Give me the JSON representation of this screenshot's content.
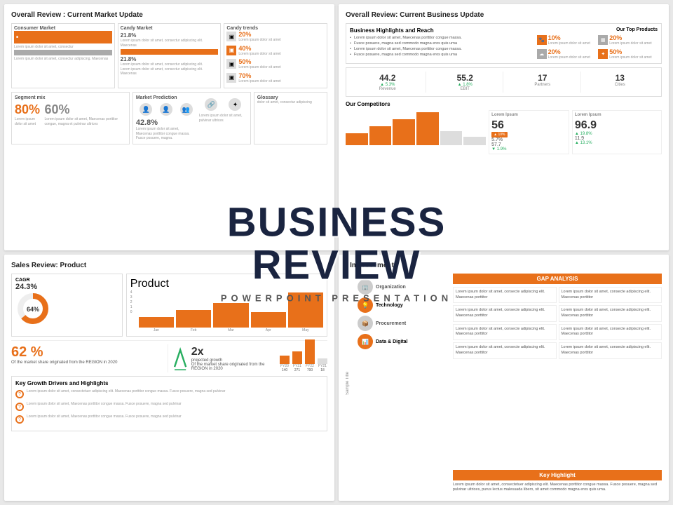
{
  "overlay": {
    "main_title_line1": "BUSINESS",
    "main_title_line2": "REVIEW",
    "subtitle": "POWERPOINT PRESENTATION"
  },
  "slide1": {
    "title": "Overall Review : Current Market Update",
    "consumer_label": "Consumer Market",
    "candy_label": "Candy Market",
    "trends_label": "Candy trends",
    "segment_label": "Segment mix",
    "prediction_label": "Market Prediction",
    "glossary_label": "Glossary",
    "pct1": "21.8%",
    "pct2": "21.8%",
    "pct3": "20%",
    "pct4": "40%",
    "pct5": "50%",
    "pct6": "70%",
    "pct7": "80%",
    "pct8": "60%",
    "pct9": "42.8%",
    "lorem": "Lorem ipsum dolor sit amet, consectur adipiscing elit. Maecenas porttitor congue massa.",
    "lorem2": "lorem ipsum dolor sit amet, consectur adipiscing elit."
  },
  "slide2": {
    "title": "Overall Review: Current Business Update",
    "highlights_title": "Business Highlights and Reach",
    "bullet1": "Lorem ipsum dolor sit amet, Maecenas porttitor congue massa.",
    "bullet2": "Fusce posuere, magna sed commodo magna eros quis urna",
    "bullet3": "Lorem ipsum dolor sit amet, Maecenas porttitor congue massa.",
    "bullet4": "Fusce posuere, magna sed commodo magna eros quis urna",
    "top_products": "Our Top Products",
    "pct_tp1": "10%",
    "pct_tp2": "20%",
    "pct_tp3": "20%",
    "pct_tp4": "50%",
    "revenue_value": "44.2",
    "revenue_label": "Revenue",
    "revenue_change": "▲ 5.3%",
    "ebit_value": "55.2",
    "ebit_label": "EBIT",
    "ebit_change": "▲ 1.8%",
    "partners_value": "17",
    "partners_label": "Partners",
    "cities_value": "13",
    "cities_label": "Cities",
    "competitors_title": "Our Competitors",
    "comp1_value": "56",
    "comp1_sub1": "5.7%",
    "comp1_sub2": "57.7",
    "comp1_change1": "▲ 10%",
    "comp1_change2": "▼ 1.9%",
    "comp2_value": "96.9",
    "comp2_sub": "11.9",
    "comp2_change1": "▲ 19.8%",
    "comp2_change2": "▲ 13.1%",
    "comp1_label": "Lorem Ipsum",
    "comp2_label": "Lorem Ipsum"
  },
  "slide3": {
    "title": "Sales Review: Product",
    "cagr_label": "CAGR",
    "cagr_value": "24.3%",
    "donut_pct": "64%",
    "product_label": "Product",
    "bar_labels": [
      "Jan",
      "Feb",
      "Mar",
      "Apr",
      "May"
    ],
    "bar_vals": [
      1,
      2,
      3,
      2,
      4
    ],
    "market_pct": "62 %",
    "market_desc": "Of the market share originated from the REGION in 2020",
    "growth_value": "2x",
    "growth_label": "projected growth",
    "growth_desc": "Of the market share originated from the REGION in 2020",
    "fy_labels": [
      "FY20",
      "FY21",
      "FY22",
      "FY21"
    ],
    "fy_vals": [
      140,
      271,
      700,
      18
    ],
    "key_title": "Key Growth Drivers and Highlights",
    "key1": "Lorem ipsum dolor sit amet, consectetuer adipiscing elit. Maecenas porttitor congue massa. Fusce posuere, magna sed pulvinar",
    "key2": "Lorem ipsum dolor sit amet, Maecenas porttitor congue massa. Fusce posuere, magna sed pulvinar",
    "key3": "Lorem ipsum dolor sit amet, Maecenas porttitor congue massa. Fusce posuere, magna sed pulvinar"
  },
  "slide4": {
    "title": ": Improvement",
    "gap_label": "GAP ANALYSIS",
    "rows": [
      {
        "label": "Organization",
        "icon": "🏢",
        "col1": "Lorem ipsum dolor sit amet, consecte adipiscing elit. Maecenas porttitor",
        "col2": "Lorem ipsum dolor sit amet, consecte adipiscing elit. Maecenas porttitor"
      },
      {
        "label": "Technology",
        "icon": "💡",
        "col1": "Lorem ipsum dolor sit amet, consecte adipiscing elit. Maecenas porttitor",
        "col2": "Lorem ipsum dolor sit amet, consecte adipiscing elit. Maecenas porttitor"
      },
      {
        "label": "Procurement",
        "icon": "📦",
        "col1": "Lorem ipsum dolor sit amet, consecte adipiscing elit. Maecenas porttitor",
        "col2": "Lorem ipsum dolor sit amet, consecte adipiscing elit. Maecenas porttitor"
      },
      {
        "label": "Data & Digital",
        "icon": "📊",
        "col1": "Lorem ipsum dolor sit amet, consecte adipiscing elit. Maecenas porttitor",
        "col2": "Lorem ipsum dolor sit amet, consecte adipiscing elit. Maecenas porttitor"
      }
    ],
    "sample_title": "Sample Title",
    "key_highlight": "Key Highlight",
    "key_highlight_text": "Lorem ipsum dolor sit amet, consectetuer adipiscing elit. Maecenas porttitor congue massa. Fusce posuere, magna sed pulvinar ultrices, purus lectus malesuada libero, sit amet commodo magna eros quis urna."
  }
}
